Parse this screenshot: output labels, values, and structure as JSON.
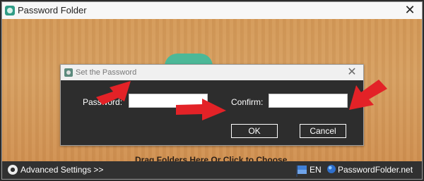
{
  "window": {
    "title": "Password Folder",
    "close_symbol": "✕"
  },
  "dialog": {
    "title": "Set the Password",
    "close_symbol": "✕",
    "password_label": "Password:",
    "password_value": "",
    "confirm_label": "Confirm:",
    "confirm_value": "",
    "ok_label": "OK",
    "cancel_label": "Cancel"
  },
  "main": {
    "drag_text": "Drag Folders Here Or Click to Choose"
  },
  "statusbar": {
    "settings_label": "Advanced Settings >>",
    "language": "EN",
    "site": "PasswordFolder.net"
  },
  "icons": {
    "app": "folder-lock-icon",
    "dialog": "folder-lock-icon",
    "settings": "gear-icon",
    "language": "flag-icon",
    "site": "globe-icon",
    "annotation": "red-arrow-icon"
  },
  "colors": {
    "wood": "#d59a58",
    "dialog_bg": "#2d2d2d",
    "statusbar_bg": "#313131",
    "arrow_red": "#e32227",
    "brand_green": "#44b99b"
  }
}
